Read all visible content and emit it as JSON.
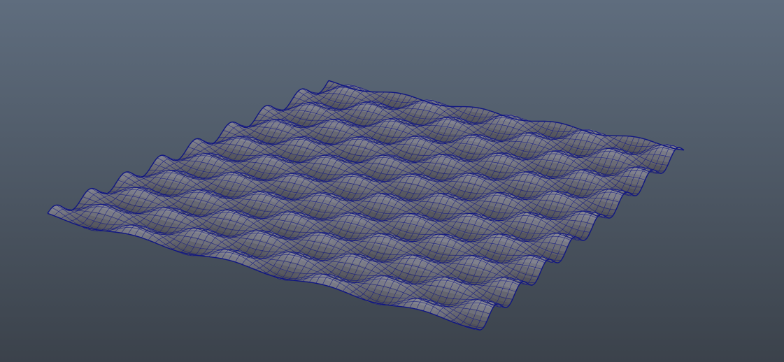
{
  "viewport": {
    "background": {
      "top_color": "#5f6d7e",
      "bottom_color": "#3b424b"
    },
    "object": {
      "type": "wave-deformed-plane",
      "display_mode": "smooth-shaded-with-wireframe",
      "shade_color": "#8a8b98",
      "wire_color": "#101682",
      "wave_crests_across": 8,
      "wave_rows_along": 9
    }
  }
}
